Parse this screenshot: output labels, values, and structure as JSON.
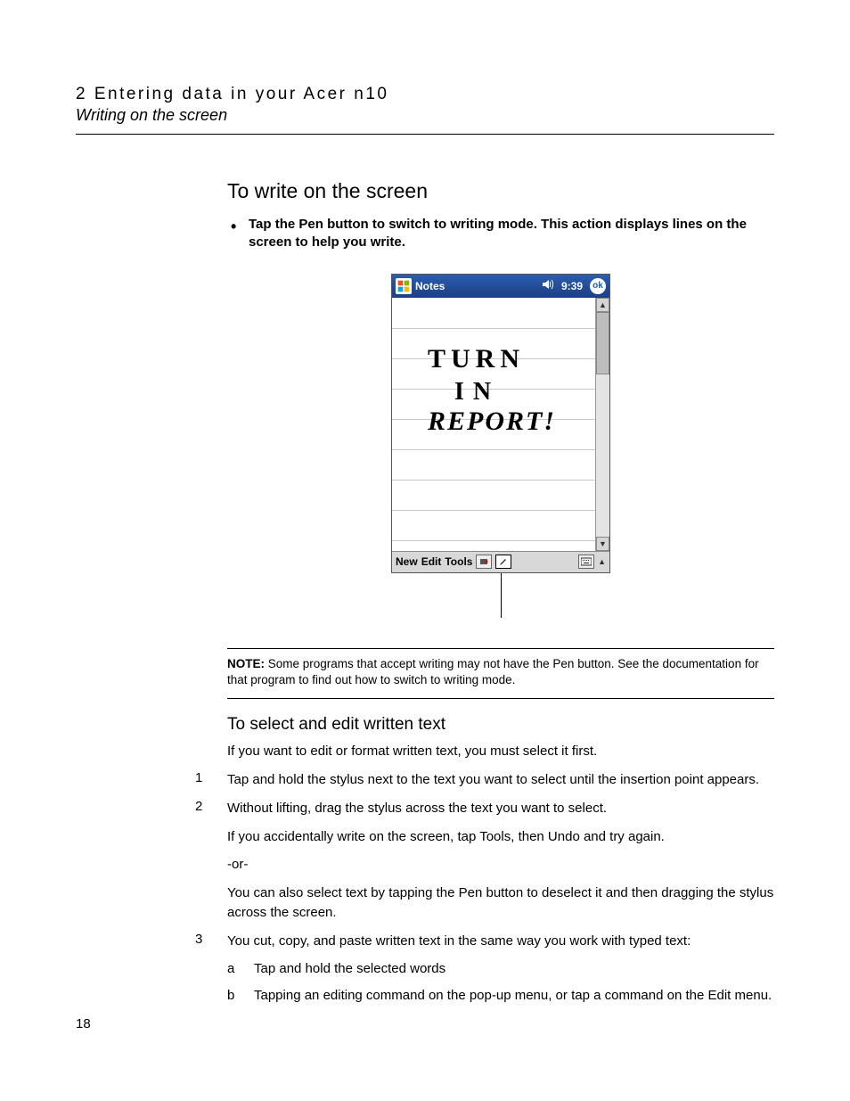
{
  "header": {
    "chapter": "2 Entering data in your Acer n10",
    "section": "Writing on the screen"
  },
  "sections": {
    "write_heading": "To write on the screen",
    "write_bullet": "Tap the Pen button to switch to writing mode. This action displays lines on the screen to help you write.",
    "select_heading": "To select and edit written text",
    "select_intro": "If you want to edit or format written text, you must select it first."
  },
  "note": {
    "label": "NOTE:",
    "text": "Some programs that accept writing may not have the Pen button. See the documentation for that program to find out how to switch to writing mode."
  },
  "steps": {
    "s1_num": "1",
    "s1": "Tap and hold the stylus next to the text you want to select until the insertion point appears.",
    "s2_num": "2",
    "s2": "Without lifting, drag the stylus across the text you want to select.",
    "s2b": "If you accidentally write on the screen, tap Tools, then Undo and try again.",
    "s2c": "-or-",
    "s2d": "You can also select text by tapping the Pen button to deselect it and then dragging the stylus across the screen.",
    "s3_num": "3",
    "s3": "You cut, copy, and paste written text in the same way you work with typed text:",
    "s3a_l": "a",
    "s3a": "Tap and hold the selected words",
    "s3b_l": "b",
    "s3b": "Tapping an editing command on the pop-up menu, or tap a command on the Edit menu."
  },
  "device": {
    "title": "Notes",
    "time": "9:39",
    "ok": "ok",
    "handwriting_line1": "TURN",
    "handwriting_line2": "IN",
    "handwriting_line3": "REPORT!",
    "menu_new": "New",
    "menu_edit": "Edit",
    "menu_tools": "Tools"
  },
  "page_number": "18"
}
